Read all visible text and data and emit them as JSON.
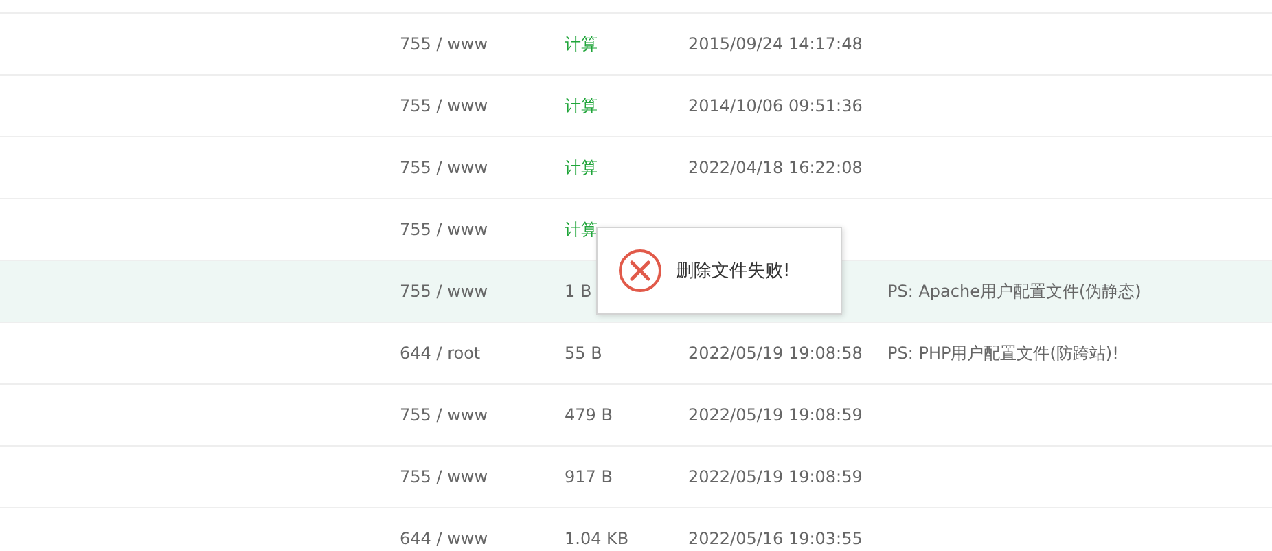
{
  "file_table": {
    "rows": [
      {
        "permission": "755 / www",
        "size": {
          "kind": "calc",
          "text": "计算"
        },
        "modified": "2015/09/24 14:17:48",
        "selected": false
      },
      {
        "permission": "755 / www",
        "size": {
          "kind": "calc",
          "text": "计算"
        },
        "modified": "2014/10/06 09:51:36",
        "selected": false
      },
      {
        "permission": "755 / www",
        "size": {
          "kind": "calc",
          "text": "计算"
        },
        "modified": "2022/04/18 16:22:08",
        "selected": false
      },
      {
        "permission": "755 / www",
        "size": {
          "kind": "calc",
          "text": "计算"
        },
        "selected": false
      },
      {
        "permission": "755 / www",
        "size": {
          "kind": "value",
          "text": "1 B"
        },
        "note": "PS: Apache用户配置文件(伪静态)",
        "selected": true
      },
      {
        "permission": "644 / root",
        "size": {
          "kind": "value",
          "text": "55 B"
        },
        "modified": "2022/05/19 19:08:58",
        "note": "PS: PHP用户配置文件(防跨站)!",
        "selected": false
      },
      {
        "permission": "755 / www",
        "size": {
          "kind": "value",
          "text": "479 B"
        },
        "modified": "2022/05/19 19:08:59",
        "selected": false
      },
      {
        "permission": "755 / www",
        "size": {
          "kind": "value",
          "text": "917 B"
        },
        "modified": "2022/05/19 19:08:59",
        "selected": false
      },
      {
        "permission": "644 / www",
        "size": {
          "kind": "value",
          "text": "1.04 KB"
        },
        "modified": "2022/05/16 19:03:55",
        "selected": false
      }
    ]
  },
  "toast": {
    "kind": "error",
    "message": "删除文件失败!"
  }
}
